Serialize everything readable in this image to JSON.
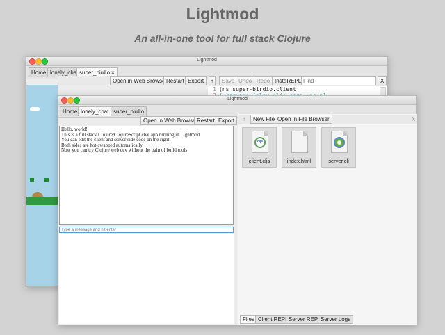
{
  "page": {
    "title": "Lightmod",
    "subtitle": "An all-in-one tool for full stack Clojure"
  },
  "colors": {
    "game_sky": "#a7d3e8",
    "game_ground": "#2f9a3f",
    "keyword": "#2a9d8f",
    "string_open": "#7a3f9e"
  },
  "back_window": {
    "title": "Lightmod",
    "tabs": [
      {
        "label": "Home"
      },
      {
        "label": "lonely_chat"
      },
      {
        "label": "super_birdio",
        "close": "×"
      }
    ],
    "preview_toolbar": [
      "Open in Web Browser",
      "Restart",
      "Export"
    ],
    "editor_toolbar": {
      "up_arrow": "↑",
      "buttons": [
        "Save",
        "Undo",
        "Redo",
        "InstaREPL"
      ],
      "find_placeholder": "Find",
      "close": "X"
    },
    "code_lines": [
      {
        "num": "1",
        "text": "(ns super-birdio.client"
      },
      {
        "num": "2",
        "text": "(:require [play-cljs.core :as p]"
      }
    ]
  },
  "front_window": {
    "title": "Lightmod",
    "tabs": [
      {
        "label": "Home"
      },
      {
        "label": "lonely_chat",
        "close": "×"
      },
      {
        "label": "super_birdio"
      }
    ],
    "preview_toolbar": [
      "Open in Web Browser",
      "Restart",
      "Export"
    ],
    "chat_lines": [
      "Hello, world!",
      "This is a full stack Clojure/ClojureScript chat app running in Lightmod",
      "You can edit the client and server side code on the right",
      "Both sides are hot-swapped automatically",
      "Now you can try Clojure web dev without the pain of build tools"
    ],
    "chat_input_placeholder": "Type a message and hit enter",
    "file_toolbar": {
      "up_arrow": "↑",
      "new_file": "New File",
      "open_in_browser": "Open in File Browser",
      "close": "X"
    },
    "files": [
      {
        "name": "client.cljs",
        "icon": "cljs-logo-icon",
        "badge": "cljs"
      },
      {
        "name": "index.html",
        "icon": "blank-file-icon"
      },
      {
        "name": "server.clj",
        "icon": "clojure-logo-icon"
      }
    ],
    "bottom_tabs": [
      "Files",
      "Client REPL",
      "Server REPL",
      "Server Logs"
    ]
  }
}
